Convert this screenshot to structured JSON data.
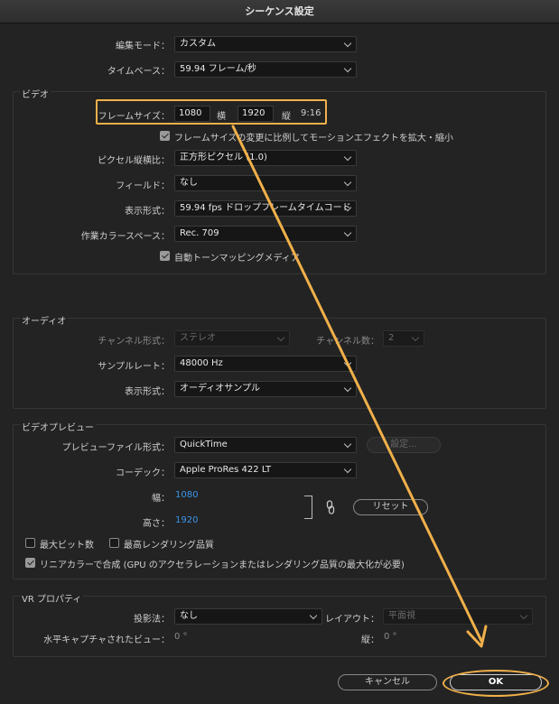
{
  "window": {
    "title": "シーケンス設定"
  },
  "top": {
    "edit_mode_label": "編集モード：",
    "edit_mode_value": "カスタム",
    "timebase_label": "タイムベース：",
    "timebase_value": "59.94  フレーム/秒"
  },
  "video": {
    "section_title": "ビデオ",
    "frame_size_label": "フレームサイズ：",
    "width_value": "1080",
    "width_unit": "横",
    "height_value": "1920",
    "height_unit": "縦",
    "aspect": "9:16",
    "scale_checkbox_label": "フレームサイズの変更に比例してモーションエフェクトを拡大・縮小",
    "scale_checked": true,
    "pixel_aspect_label": "ピクセル縦横比：",
    "pixel_aspect_value": "正方形ピクセル (1.0)",
    "fields_label": "フィールド：",
    "fields_value": "なし",
    "display_format_label": "表示形式：",
    "display_format_value": "59.94 fps ドロップフレームタイムコード",
    "color_space_label": "作業カラースペース：",
    "color_space_value": "Rec. 709",
    "tone_mapping_label": "自動トーンマッピングメディア",
    "tone_mapping_checked": true
  },
  "audio": {
    "section_title": "オーディオ",
    "channel_format_label": "チャンネル形式：",
    "channel_format_value": "ステレオ",
    "channel_count_label": "チャンネル数：",
    "channel_count_value": "2",
    "sample_rate_label": "サンプルレート：",
    "sample_rate_value": "48000 Hz",
    "display_format_label": "表示形式：",
    "display_format_value": "オーディオサンプル"
  },
  "preview": {
    "section_title": "ビデオプレビュー",
    "file_format_label": "プレビューファイル形式：",
    "file_format_value": "QuickTime",
    "settings_button": "設定...",
    "codec_label": "コーデック：",
    "codec_value": "Apple ProRes 422 LT",
    "width_label": "幅：",
    "width_value": "1080",
    "height_label": "高さ：",
    "height_value": "1920",
    "reset_button": "リセット",
    "max_bit_depth_label": "最大ビット数",
    "max_bit_depth_checked": false,
    "max_render_quality_label": "最高レンダリング品質",
    "max_render_quality_checked": false,
    "linear_color_label": "リニアカラーで合成 (GPU のアクセラレーションまたはレンダリング品質の最大化が必要)",
    "linear_color_checked": true
  },
  "vr": {
    "section_title": "VR プロパティ",
    "projection_label": "投影法：",
    "projection_value": "なし",
    "layout_label": "レイアウト：",
    "layout_value": "平面視",
    "h_capture_label": "水平キャプチャされたビュー：",
    "h_capture_value": "0 °",
    "v_label": "縦：",
    "v_value": "0 °"
  },
  "buttons": {
    "cancel": "キャンセル",
    "ok": "OK"
  },
  "colors": {
    "annotation": "#f0b04a",
    "accent_blue": "#3b94e8"
  }
}
